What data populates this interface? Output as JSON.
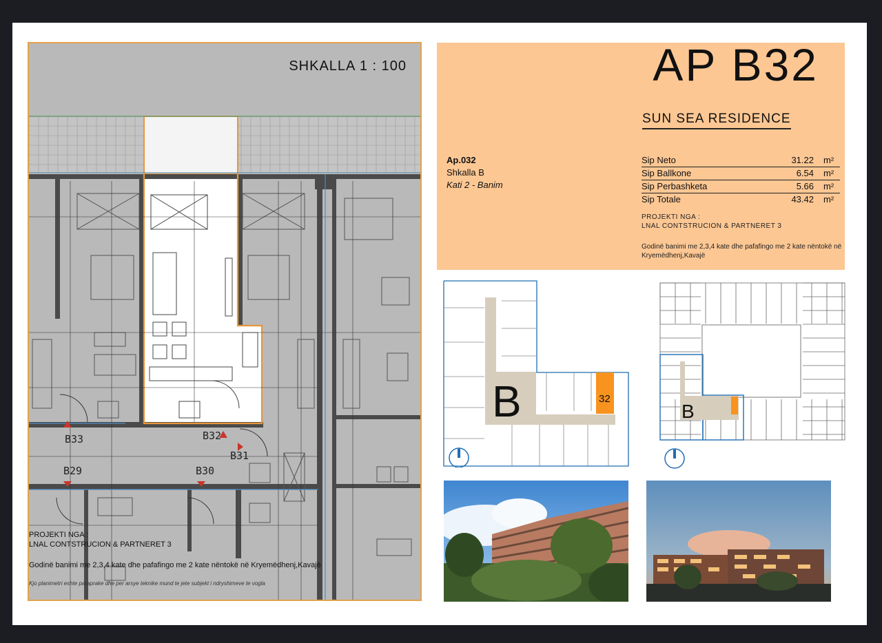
{
  "plan": {
    "scale_text": "SHKALLA 1 : 100",
    "unit_labels": [
      "B33",
      "B32",
      "B31",
      "B29",
      "B30"
    ],
    "project_by": "PROJEKTI NGA :",
    "company": "LNAL CONTSTRUCION & PARTNERET 3",
    "description": "Godinë banimi me 2,3,4 kate dhe pafafingo me 2 kate nëntokë në Kryemëdhenj,Kavajë",
    "disclaimer": "Kjo planimetri eshte paraprake dhe per arsye teknike mund te jete subjekt i ndryshimeve te vogla",
    "highlight_color": "#e8973a"
  },
  "info": {
    "ap_title": "AP B32",
    "residence": "SUN SEA RESIDENCE",
    "ap_number": "Ap.032",
    "stair": "Shkalla B",
    "floor": "Kati 2 - Banim",
    "areas": [
      {
        "label": "Sip Neto",
        "value": "31.22",
        "unit": "m²"
      },
      {
        "label": "Sip Ballkone",
        "value": "6.54",
        "unit": "m²"
      },
      {
        "label": "Sip Perbashketa",
        "value": "5.66",
        "unit": "m²"
      },
      {
        "label": "Sip Totale",
        "value": "43.42",
        "unit": "m²"
      }
    ],
    "project_by": "PROJEKTI NGA :",
    "company": "LNAL CONTSTRUCION & PARTNERET 3",
    "description": "Godinë banimi me 2,3,4 kate dhe pafafingo me 2 kate nëntokë në Kryemëdhenj,Kavajë",
    "background": "#fcc793"
  },
  "keyplan_b": {
    "block_letter": "B",
    "unit_number": "32",
    "unit_color": "#f7931e"
  },
  "keyplan_site": {
    "block_letter": "B"
  },
  "photos": [
    {
      "name": "day-render"
    },
    {
      "name": "dusk-render"
    }
  ]
}
